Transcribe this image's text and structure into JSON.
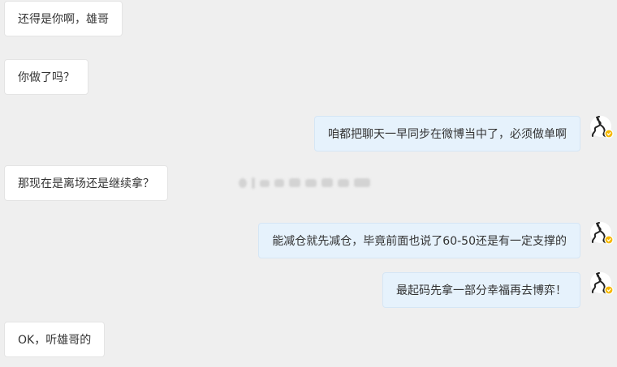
{
  "conversation": {
    "messages": [
      {
        "side": "left",
        "text": "还得是你啊，雄哥"
      },
      {
        "side": "left",
        "text": "你做了吗？"
      },
      {
        "side": "right",
        "text": "咱都把聊天一早同步在微博当中了，必须做单啊"
      },
      {
        "side": "left",
        "text": "那现在是离场还是继续拿？"
      },
      {
        "side": "right",
        "text": "能减仓就先减仓，毕竟前面也说了60-50还是有一定支撑的"
      },
      {
        "side": "right",
        "text": "最起码先拿一部分幸福再去博弈！"
      },
      {
        "side": "left",
        "text": "OK，听雄哥的"
      }
    ]
  },
  "colors": {
    "background": "#efefef",
    "bubble_left": "#ffffff",
    "bubble_right": "#e6f2fc",
    "text": "#333333",
    "badge": "#f5b800"
  },
  "icons": {
    "avatar": "user-avatar-icon",
    "badge": "verified-badge-icon",
    "watermark": "blurred-watermark"
  }
}
